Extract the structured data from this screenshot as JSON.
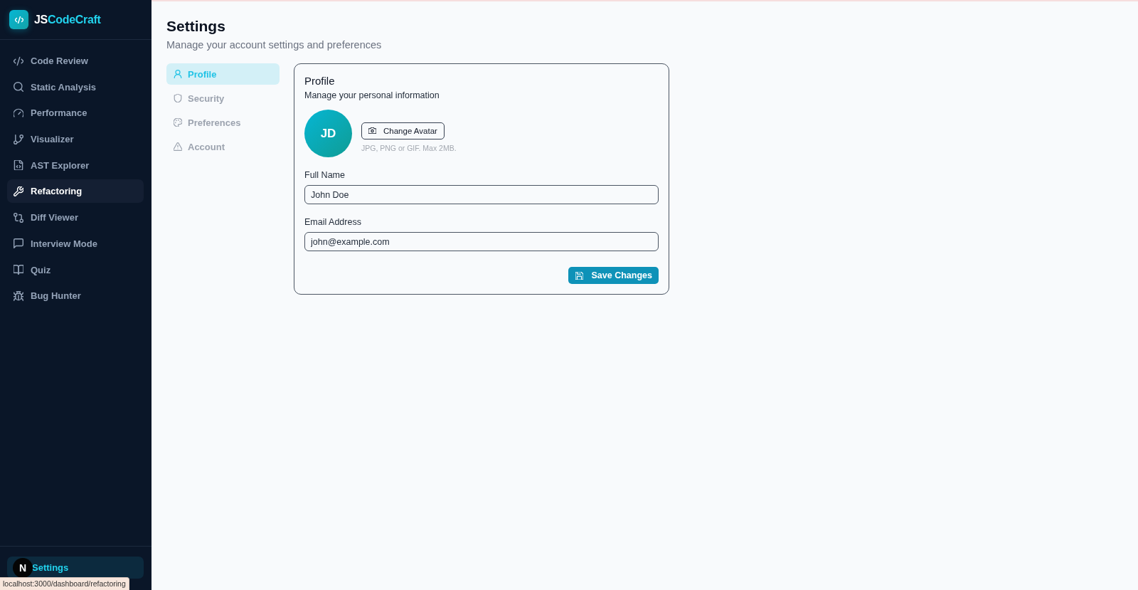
{
  "sidebar": {
    "logo": {
      "prefix": "JS",
      "name": "CodeCraft"
    },
    "items": [
      {
        "label": "Code Review",
        "kind": "code",
        "selected": false
      },
      {
        "label": "Static Analysis",
        "kind": "search",
        "selected": false
      },
      {
        "label": "Performance",
        "kind": "gauge",
        "selected": false
      },
      {
        "label": "Visualizer",
        "kind": "branch",
        "selected": false
      },
      {
        "label": "AST Explorer",
        "kind": "file-code",
        "selected": false
      },
      {
        "label": "Refactoring",
        "kind": "wrench",
        "selected": true
      },
      {
        "label": "Diff Viewer",
        "kind": "compare",
        "selected": false
      },
      {
        "label": "Interview Mode",
        "kind": "message",
        "selected": false
      },
      {
        "label": "Quiz",
        "kind": "book",
        "selected": false
      },
      {
        "label": "Bug Hunter",
        "kind": "bug",
        "selected": false
      }
    ],
    "footer": {
      "label": "Settings",
      "selected": true
    }
  },
  "dev_indicator": {
    "label": "N"
  },
  "status_tooltip": "localhost:3000/dashboard/refactoring",
  "page": {
    "title": "Settings",
    "subtitle": "Manage your account settings and preferences"
  },
  "tabs": [
    {
      "label": "Profile",
      "kind": "user",
      "selected": true
    },
    {
      "label": "Security",
      "kind": "shield",
      "selected": false
    },
    {
      "label": "Preferences",
      "kind": "palette",
      "selected": false
    },
    {
      "label": "Account",
      "kind": "alert",
      "selected": false
    }
  ],
  "card": {
    "title": "Profile",
    "subtitle": "Manage your personal information",
    "avatar": {
      "initials": "JD"
    },
    "avatar_button": "Change Avatar",
    "avatar_hint": "JPG, PNG or GIF. Max 2MB.",
    "fields": [
      {
        "label": "Full Name",
        "value": "John Doe"
      },
      {
        "label": "Email Address",
        "value": "john@example.com"
      }
    ],
    "save_button": "Save Changes"
  }
}
